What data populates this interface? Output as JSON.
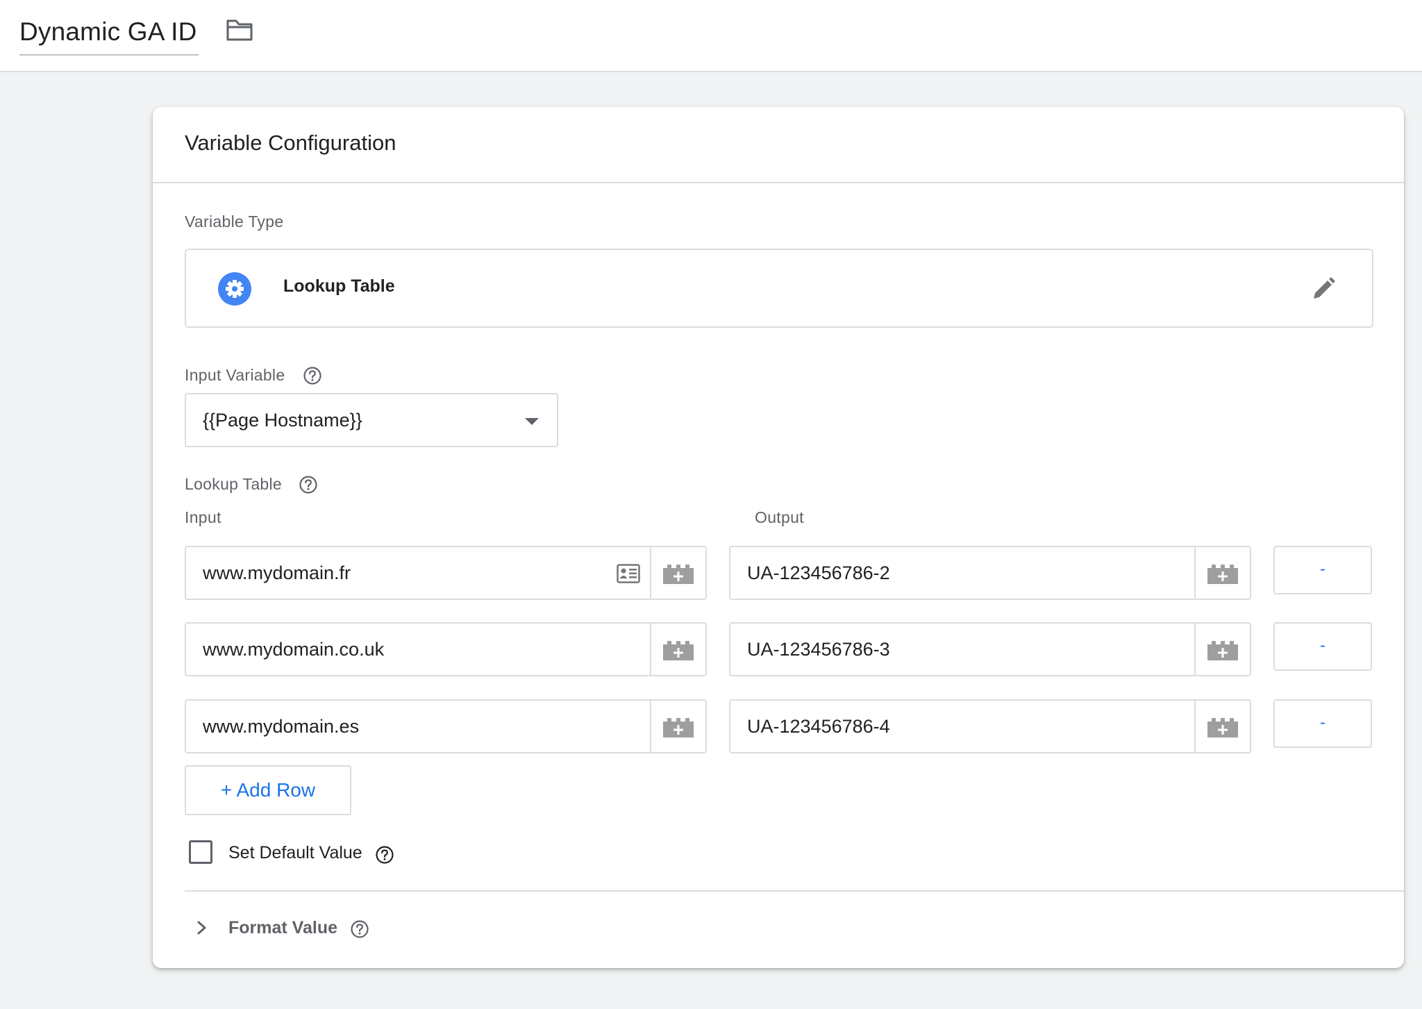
{
  "header": {
    "title": "Dynamic GA ID"
  },
  "card": {
    "title": "Variable Configuration",
    "variable_type_label": "Variable Type",
    "variable_type_name": "Lookup Table",
    "input_variable_label": "Input Variable",
    "input_variable_value": "{{Page Hostname}}",
    "lookup_table_label": "Lookup Table",
    "input_col_label": "Input",
    "output_col_label": "Output",
    "rows": [
      {
        "input": "www.mydomain.fr",
        "output": "UA-123456786-2",
        "remove_label": "-"
      },
      {
        "input": "www.mydomain.co.uk",
        "output": "UA-123456786-3",
        "remove_label": "-"
      },
      {
        "input": "www.mydomain.es",
        "output": "UA-123456786-4",
        "remove_label": "-"
      }
    ],
    "add_row_label": "+ Add Row",
    "default_value_label": "Set Default Value",
    "default_value_checked": false,
    "format_value_label": "Format Value"
  },
  "colors": {
    "accent": "#1a73e8",
    "gear": "#4285f4",
    "border": "#dadce0",
    "background": "#f1f3f4"
  },
  "icons": {
    "folder": "folder-icon",
    "gear": "gear-icon",
    "pencil": "pencil-icon",
    "help": "help-icon",
    "caret": "caret-down-icon",
    "variable_block": "variable-block-icon",
    "contact_card": "contact-card-icon",
    "chevron": "chevron-right-icon"
  }
}
